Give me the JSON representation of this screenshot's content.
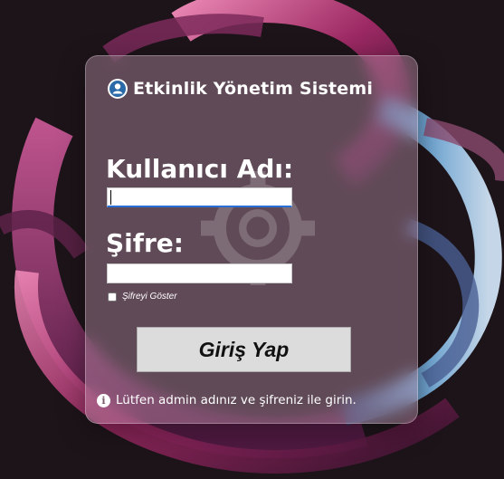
{
  "app": {
    "title": "Etkinlik Yönetim Sistemi",
    "title_icon": "user-circle-icon"
  },
  "login": {
    "username_label": "Kullanıcı Adı:",
    "username_value": "",
    "password_label": "Şifre:",
    "password_value": "",
    "show_password_label": "Şifreyi Göster",
    "show_password_checked": false,
    "submit_label": "Giriş Yap",
    "info_icon": "info-icon",
    "info_text": "Lütfen admin adınız ve şifreniz ile girin."
  },
  "colors": {
    "background": "#1d1419",
    "accent_pink": "#c2417f",
    "accent_blue": "#6fa2d6",
    "button_bg": "#dcdcdc"
  }
}
